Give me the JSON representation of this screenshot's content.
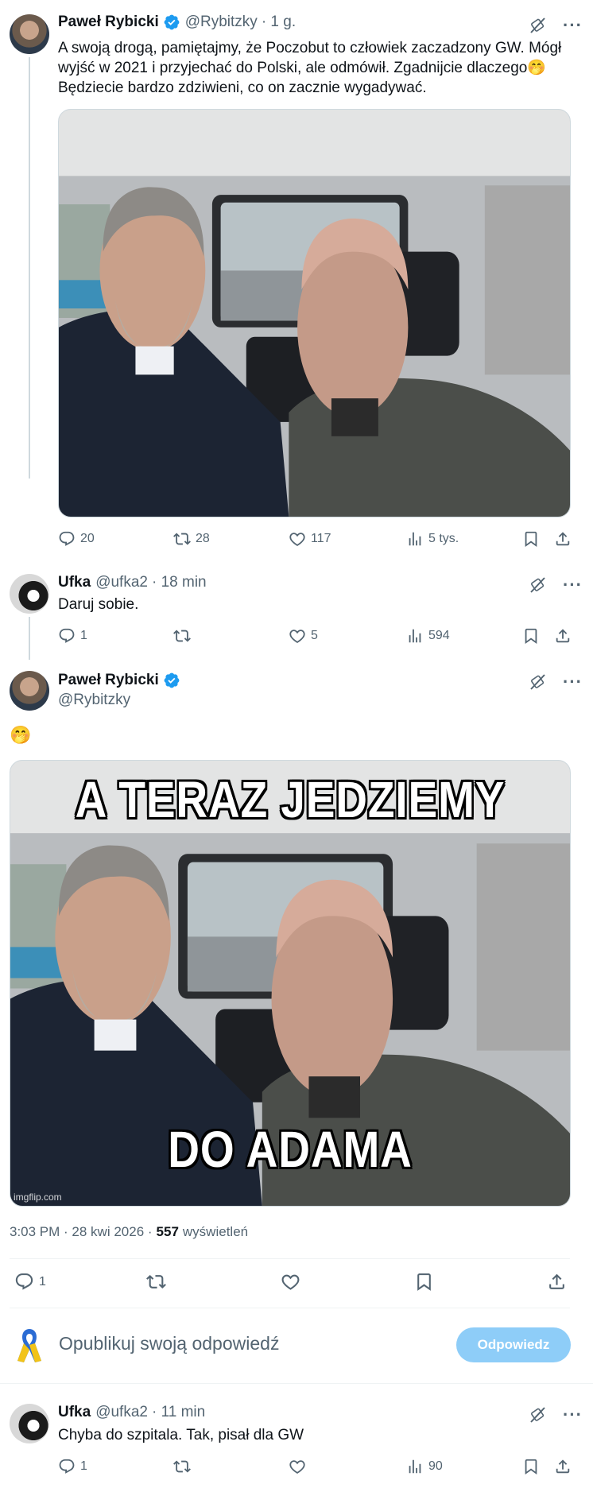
{
  "tweet1": {
    "author_name": "Paweł Rybicki",
    "handle": "@Rybitzky",
    "time": "· 1 g.",
    "text_line1": "A swoją drogą, pamiętajmy, że Poczobut to człowiek zaczadzony GW. Mógł",
    "text_line2": "wyjść w 2021 i przyjechać do Polski, ale odmówił. Zgadnijcie dlaczego🤭",
    "text_line3": "Będziecie bardzo zdziwieni, co on zacznie wygadywać.",
    "replies": "20",
    "reposts": "28",
    "likes": "117",
    "views": "5 tys."
  },
  "tweet2": {
    "author_name": "Ufka",
    "handle": "@ufka2",
    "time": "· 18 min",
    "text": "Daruj sobie.",
    "replies": "1",
    "reposts": "",
    "likes": "5",
    "views": "594"
  },
  "main_tweet": {
    "author_name": "Paweł Rybicki",
    "handle": "@Rybitzky",
    "text": "🤭",
    "meme_top": "A TERAZ JEDZIEMY",
    "meme_bottom": "DO ADAMA",
    "watermark": "imgflip.com",
    "timestamp": "3:03 PM · 28 kwi 2026 ·",
    "view_count": "557",
    "views_label": "wyświetleń",
    "replies": "1"
  },
  "compose": {
    "placeholder": "Opublikuj swoją odpowiedź",
    "button": "Odpowiedz"
  },
  "tweet3": {
    "author_name": "Ufka",
    "handle": "@ufka2",
    "time": "· 11 min",
    "text": "Chyba do szpitala. Tak, pisał dla GW",
    "replies": "1",
    "views": "90"
  },
  "colors": {
    "accent": "#1d9bf0",
    "muted": "#536471",
    "reply_button_disabled": "#8ecdf8"
  }
}
